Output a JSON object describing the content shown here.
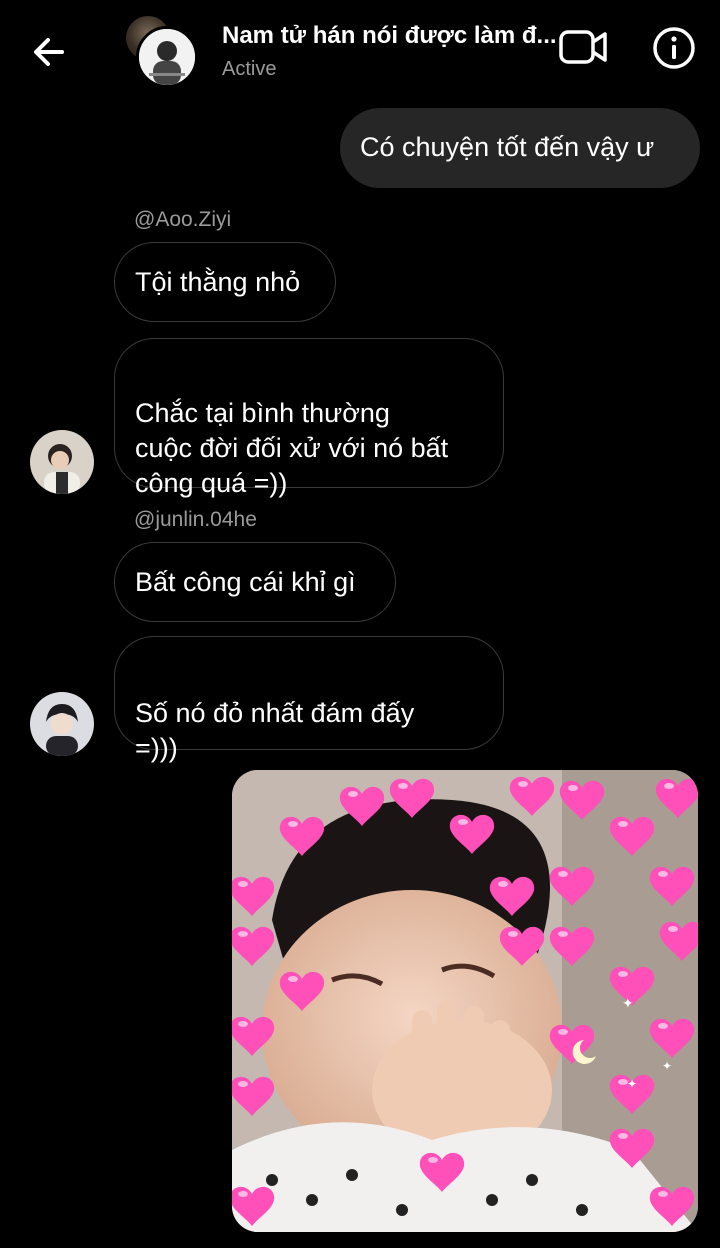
{
  "header": {
    "title": "Nam tử hán nói được làm đ...",
    "status": "Active",
    "back_icon": "arrow-left-icon",
    "video_icon": "video-camera-icon",
    "info_icon": "info-icon"
  },
  "messages": {
    "m1": {
      "text": "Có chuyện tốt đến vậy ư",
      "direction": "outgoing"
    },
    "s1": {
      "sender": "@Aoo.Ziyi"
    },
    "m2": {
      "text": "Tội thằng nhỏ"
    },
    "m3": {
      "text": "Chắc tại bình thường\ncuộc đời đối xử với nó bất\ncông quá =))"
    },
    "s2": {
      "sender": "@junlin.04he"
    },
    "m4": {
      "text": "Bất công cái khỉ gì"
    },
    "m5": {
      "text": "Số nó đỏ nhất đám đấy\n=)))"
    },
    "m6": {
      "type": "image",
      "description_icon": "heart-icon"
    }
  },
  "colors": {
    "background": "#000000",
    "outgoing_bubble": "#262626",
    "incoming_border": "#3a3a3a",
    "muted_text": "#9a9a9a",
    "heart": "#ff4fb8"
  }
}
